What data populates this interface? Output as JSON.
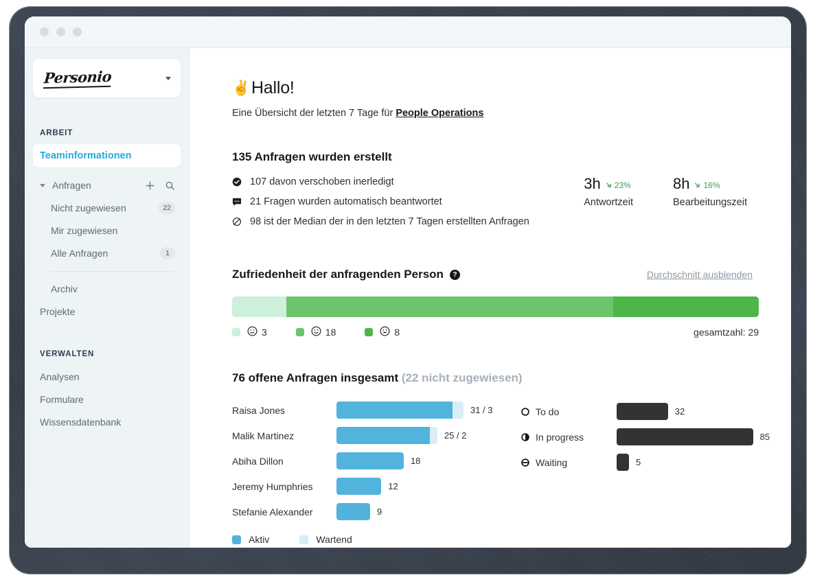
{
  "window": {
    "traffic_lights": [
      "close",
      "minimize",
      "maximize"
    ]
  },
  "sidebar": {
    "brand": "Personio",
    "brand_caret": "chevron-down",
    "sections": [
      {
        "label": "ARBEIT"
      },
      {
        "label": "VERWALTEN"
      }
    ],
    "active_item": "Teaminformationen",
    "group": {
      "label": "Anfragen",
      "add_icon": "plus-icon",
      "search_icon": "search-icon"
    },
    "items": [
      {
        "label": "Nicht zugewiesen",
        "badge": "22"
      },
      {
        "label": "Mir zugewiesen",
        "badge": ""
      },
      {
        "label": "Alle Anfragen",
        "badge": "1"
      },
      {
        "label": "Archiv",
        "badge": ""
      },
      {
        "label": "Projekte",
        "badge": ""
      }
    ],
    "manage_items": [
      {
        "label": "Analysen"
      },
      {
        "label": "Formulare"
      },
      {
        "label": "Wissensdatenbank"
      }
    ]
  },
  "main": {
    "greeting_emoji": "✌️",
    "greeting": "Hallo!",
    "subtitle_prefix": "Eine Übersicht der letzten 7 Tage für ",
    "subtitle_link": "People Operations",
    "created": {
      "title": "135 Anfragen wurden erstellt",
      "lines": [
        {
          "icon": "check-circle-icon",
          "glyph": "✔",
          "text": "107 davon verschoben inerledigt"
        },
        {
          "icon": "speech-bubble-icon",
          "glyph": "▰",
          "text": "21 Fragen wurden automatisch beantwortet"
        },
        {
          "icon": "average-icon",
          "glyph": "Ø",
          "text": "98 ist der Median der in den letzten 7 Tagen erstellten Anfragen"
        }
      ]
    },
    "kpis": [
      {
        "value": "3h",
        "delta": "23%",
        "trend": "down",
        "label": "Antwortzeit"
      },
      {
        "value": "8h",
        "delta": "16%",
        "trend": "down",
        "label": "Bearbeitungszeit"
      }
    ],
    "satisfaction": {
      "title": "Zufriedenheit der anfragenden Person",
      "help": "?",
      "toggle": "Durchschnitt ausblenden",
      "total": "gesamtzahl: 29",
      "segments": [
        {
          "face": "neutral-face",
          "glyph": "😐",
          "count": "3",
          "color": "#cdf0da"
        },
        {
          "face": "slight-smile-face",
          "glyph": "🙂",
          "count": "18",
          "color": "#6cc56c"
        },
        {
          "face": "grinning-face",
          "glyph": "😀",
          "count": "8",
          "color": "#4cb648"
        }
      ]
    },
    "open_requests": {
      "title": "76 offene Anfragen insgesamt",
      "subtitle": "(22 nicht zugewiesen)",
      "legend": [
        {
          "label": "Aktiv",
          "color": "#52b3dd"
        },
        {
          "label": "Wartend",
          "color": "#d9ecf7"
        }
      ],
      "people": [
        {
          "name": "Raisa Jones",
          "active": 31,
          "waiting": 3,
          "value": "31 / 3"
        },
        {
          "name": "Malik Martinez",
          "active": 25,
          "waiting": 2,
          "value": "25 / 2"
        },
        {
          "name": "Abiha Dillon",
          "active": 18,
          "waiting": 0,
          "value": "18"
        },
        {
          "name": "Jeremy Humphries",
          "active": 12,
          "waiting": 0,
          "value": "12"
        },
        {
          "name": "Stefanie Alexander",
          "active": 9,
          "waiting": 0,
          "value": "9"
        }
      ],
      "statuses": [
        {
          "icon": "empty-circle-icon",
          "label": "To do",
          "value": 32,
          "value_text": "32"
        },
        {
          "icon": "half-circle-icon",
          "label": "In progress",
          "value": 85,
          "value_text": "85"
        },
        {
          "icon": "minus-circle-icon",
          "label": "Waiting",
          "value": 5,
          "value_text": "5"
        }
      ]
    }
  },
  "chart_data": [
    {
      "type": "bar",
      "title": "Zufriedenheit der anfragenden Person",
      "orientation": "stacked-horizontal",
      "categories": [
        "neutral",
        "slight-smile",
        "grinning"
      ],
      "values": [
        3,
        18,
        8
      ],
      "colors": [
        "#cdf0da",
        "#6cc56c",
        "#4cb648"
      ],
      "total": 29,
      "xlabel": "",
      "ylabel": "",
      "grid": false,
      "legend": "bottom-left"
    },
    {
      "type": "bar",
      "title": "76 offene Anfragen insgesamt (22 nicht zugewiesen)",
      "orientation": "horizontal",
      "categories": [
        "Raisa Jones",
        "Malik Martinez",
        "Abiha Dillon",
        "Jeremy Humphries",
        "Stefanie Alexander"
      ],
      "series": [
        {
          "name": "Aktiv",
          "values": [
            31,
            25,
            18,
            12,
            9
          ],
          "color": "#52b3dd"
        },
        {
          "name": "Wartend",
          "values": [
            3,
            2,
            0,
            0,
            0
          ],
          "color": "#d9ecf7"
        }
      ],
      "xlim": [
        0,
        34
      ],
      "xlabel": "",
      "ylabel": "",
      "grid": false,
      "legend": "bottom-left"
    },
    {
      "type": "bar",
      "title": "Status",
      "orientation": "horizontal",
      "categories": [
        "To do",
        "In progress",
        "Waiting"
      ],
      "values": [
        32,
        85,
        5
      ],
      "colors": [
        "#333333",
        "#333333",
        "#333333"
      ],
      "xlim": [
        0,
        92
      ],
      "xlabel": "",
      "ylabel": "",
      "grid": false,
      "legend": "none"
    }
  ]
}
